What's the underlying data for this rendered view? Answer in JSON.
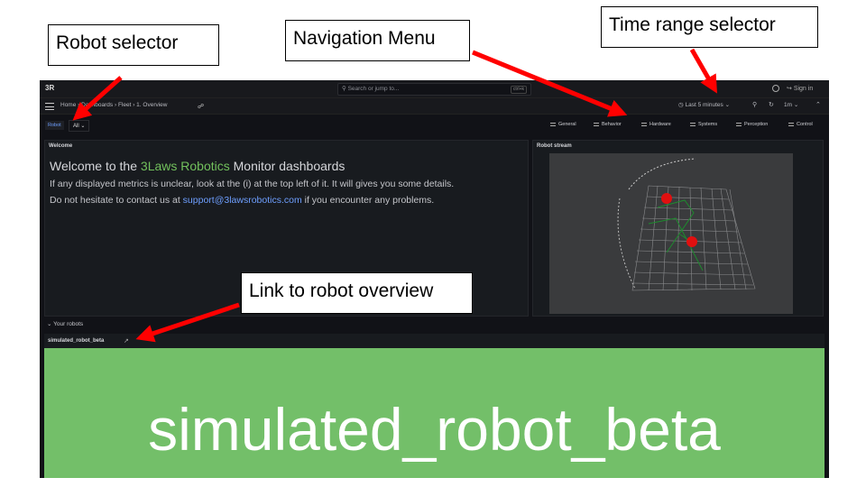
{
  "annotations": {
    "robot_selector": "Robot selector",
    "navigation_menu": "Navigation Menu",
    "time_range_selector": "Time range selector",
    "robot_overview_link": "Link to robot overview"
  },
  "colors": {
    "arrow": "#ff0000",
    "brand_green": "#72c05c",
    "link_blue": "#6e9fff",
    "tile_green": "#73bf69"
  },
  "topbar": {
    "logo": "3R",
    "search_placeholder": "Search or jump to...",
    "search_shortcut": "ctrl+k",
    "help_icon": "help-circle-icon",
    "signin": "Sign in"
  },
  "navbar": {
    "breadcrumb": "Home › Dashboards › Fleet › 1. Overview",
    "time_range": "Last 5 minutes",
    "refresh_interval": "1m"
  },
  "variables": {
    "label": "Robot",
    "value": "All"
  },
  "nav_links": [
    {
      "label": "General"
    },
    {
      "label": "Behavior"
    },
    {
      "label": "Hardware"
    },
    {
      "label": "Systems"
    },
    {
      "label": "Perception"
    },
    {
      "label": "Control"
    }
  ],
  "welcome_panel": {
    "title": "Welcome",
    "heading_prefix": "Welcome to the ",
    "heading_brand": "3Laws Robotics",
    "heading_suffix": " Monitor dashboards",
    "line1": "If any displayed metrics is unclear, look at the (i) at the top left of it. It will gives you some details.",
    "line2_prefix": "Do not hesitate to contact us at ",
    "line2_email": "support@3lawsrobotics.com",
    "line2_suffix": " if you encounter any problems."
  },
  "stream_panel": {
    "title": "Robot stream"
  },
  "robots_row": {
    "title": "⌄ Your robots",
    "robot_name": "simulated_robot_beta",
    "tile_text": "simulated_robot_beta"
  }
}
